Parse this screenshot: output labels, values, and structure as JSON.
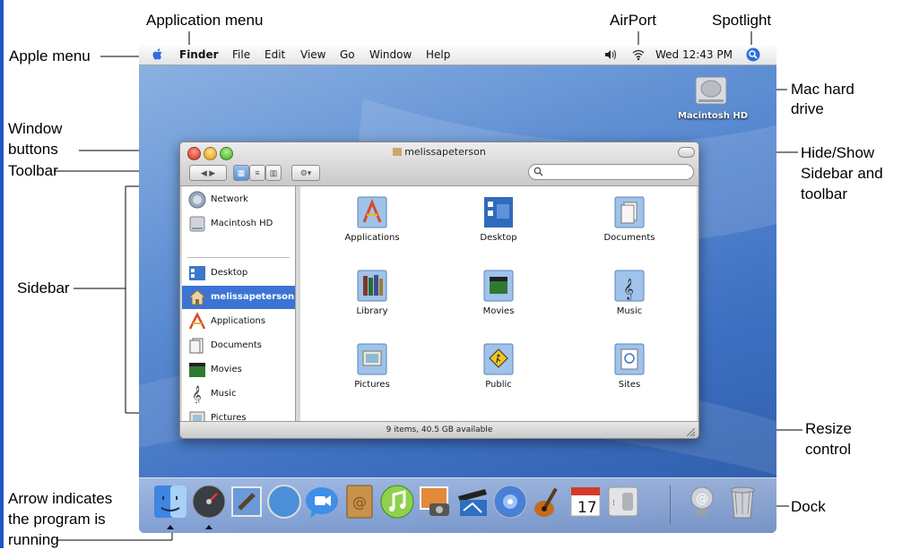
{
  "annotations": {
    "application_menu": "Application menu",
    "airport": "AirPort",
    "spotlight": "Spotlight",
    "apple_menu": "Apple menu",
    "mac_hard_drive": [
      "Mac hard",
      "drive"
    ],
    "window_buttons": [
      "Window",
      "buttons"
    ],
    "hide_show": [
      "Hide/Show",
      "Sidebar and",
      "toolbar"
    ],
    "toolbar": "Toolbar",
    "sidebar": "Sidebar",
    "resize_control": [
      "Resize",
      "control"
    ],
    "arrow_note": [
      "Arrow indicates",
      "the program is",
      "running"
    ],
    "dock": "Dock"
  },
  "menubar": {
    "items": [
      "Finder",
      "File",
      "Edit",
      "View",
      "Go",
      "Window",
      "Help"
    ],
    "clock": "Wed 12:43 PM",
    "icons": [
      "apple-icon",
      "volume-icon",
      "airport-icon",
      "spotlight-icon"
    ]
  },
  "desktop": {
    "hd_label": "Macintosh HD"
  },
  "window": {
    "title": "melissapeterson",
    "status": "9 items, 40.5 GB available",
    "sidebar": [
      {
        "label": "Network",
        "icon": "network-icon"
      },
      {
        "label": "Macintosh HD",
        "icon": "harddrive-icon"
      },
      {
        "label": "Desktop",
        "icon": "desktop-icon"
      },
      {
        "label": "melissapeterson",
        "icon": "home-icon"
      },
      {
        "label": "Applications",
        "icon": "applications-icon"
      },
      {
        "label": "Documents",
        "icon": "documents-icon"
      },
      {
        "label": "Movies",
        "icon": "movies-icon"
      },
      {
        "label": "Music",
        "icon": "music-icon"
      },
      {
        "label": "Pictures",
        "icon": "pictures-icon"
      }
    ],
    "selected_sidebar_item": "melissapeterson",
    "folders": [
      {
        "label": "Applications"
      },
      {
        "label": "Desktop"
      },
      {
        "label": "Documents"
      },
      {
        "label": "Library"
      },
      {
        "label": "Movies"
      },
      {
        "label": "Music"
      },
      {
        "label": "Pictures"
      },
      {
        "label": "Public"
      },
      {
        "label": "Sites"
      }
    ]
  },
  "dock": {
    "icons": [
      "finder-icon",
      "dashboard-icon",
      "mail-icon",
      "safari-icon",
      "ichat-icon",
      "address-book-icon",
      "itunes-icon",
      "iphoto-icon",
      "imovie-icon",
      "idvd-icon",
      "garageband-icon",
      "ical-icon",
      "preferences-icon",
      "downloads-stack-icon",
      "trash-icon"
    ],
    "calendar_day": "17"
  },
  "colors": {
    "selection": "#3b74d4",
    "desktop": "#4f7fcb"
  }
}
